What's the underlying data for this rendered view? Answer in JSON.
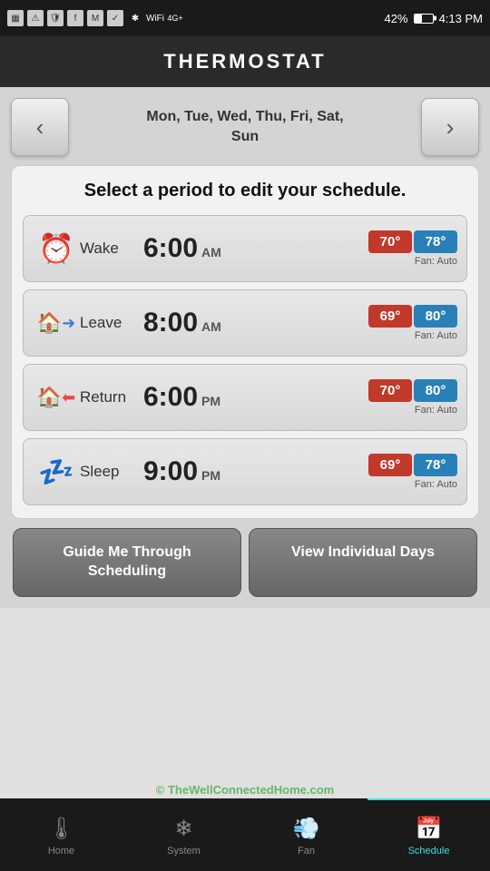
{
  "statusBar": {
    "battery": "42%",
    "time": "4:13 PM",
    "signal": "4G+"
  },
  "header": {
    "title": "THERMOSTAT"
  },
  "nav": {
    "prevArrow": "‹",
    "nextArrow": "›",
    "days": "Mon, Tue, Wed, Thu, Fri, Sat,\nSun"
  },
  "scheduleCard": {
    "title": "Select a period to edit your schedule.",
    "periods": [
      {
        "icon": "⏰",
        "label": "Wake",
        "time": "6:00",
        "ampm": "AM",
        "heatTemp": "70°",
        "coolTemp": "78°",
        "fan": "Fan: Auto"
      },
      {
        "icon": "🏠➡",
        "label": "Leave",
        "time": "8:00",
        "ampm": "AM",
        "heatTemp": "69°",
        "coolTemp": "80°",
        "fan": "Fan: Auto"
      },
      {
        "icon": "🏠⬅",
        "label": "Return",
        "time": "6:00",
        "ampm": "PM",
        "heatTemp": "70°",
        "coolTemp": "80°",
        "fan": "Fan: Auto"
      },
      {
        "icon": "💤",
        "label": "Sleep",
        "time": "9:00",
        "ampm": "PM",
        "heatTemp": "69°",
        "coolTemp": "78°",
        "fan": "Fan: Auto"
      }
    ]
  },
  "buttons": {
    "guide": "Guide Me Through Scheduling",
    "viewDays": "View Individual Days"
  },
  "footer": {
    "items": [
      {
        "icon": "🌡",
        "label": "Home",
        "active": false
      },
      {
        "icon": "❄",
        "label": "System",
        "active": false
      },
      {
        "icon": "💨",
        "label": "Fan",
        "active": false
      },
      {
        "icon": "📅",
        "label": "Schedule",
        "active": true
      }
    ]
  },
  "watermark": "© TheWellConnectedHome.com"
}
